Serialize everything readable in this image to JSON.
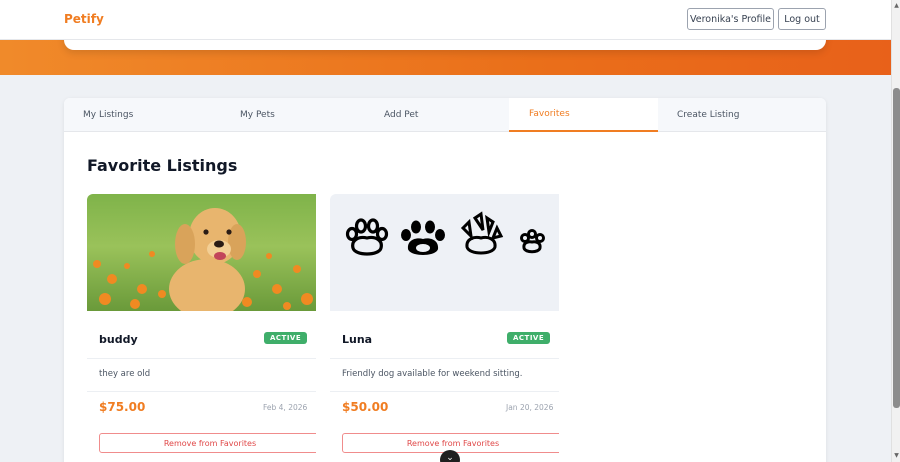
{
  "nav": {
    "brand": "Petify",
    "profile_label": "Veronika's Profile",
    "logout_label": "Log out"
  },
  "tabs": [
    {
      "label": "My Listings",
      "active": false
    },
    {
      "label": "My Pets",
      "active": false
    },
    {
      "label": "Add Pet",
      "active": false
    },
    {
      "label": "Favorites",
      "active": true
    },
    {
      "label": "Create Listing",
      "active": false
    }
  ],
  "main": {
    "title": "Favorite Listings"
  },
  "listings": [
    {
      "name": "buddy",
      "status": "ACTIVE",
      "description": "they are old",
      "price": "$75.00",
      "date": "Feb 4, 2026",
      "action_label": "Remove from Favorites",
      "image": "golden-retriever-puppy-photo"
    },
    {
      "name": "Luna",
      "status": "ACTIVE",
      "description": "Friendly dog available for weekend sitting.",
      "price": "$50.00",
      "date": "Jan 20, 2026",
      "action_label": "Remove from Favorites",
      "image": "paw-prints-placeholder"
    }
  ],
  "colors": {
    "accent": "#f07d22",
    "active_badge": "#3fae6a",
    "remove": "#e04848"
  }
}
